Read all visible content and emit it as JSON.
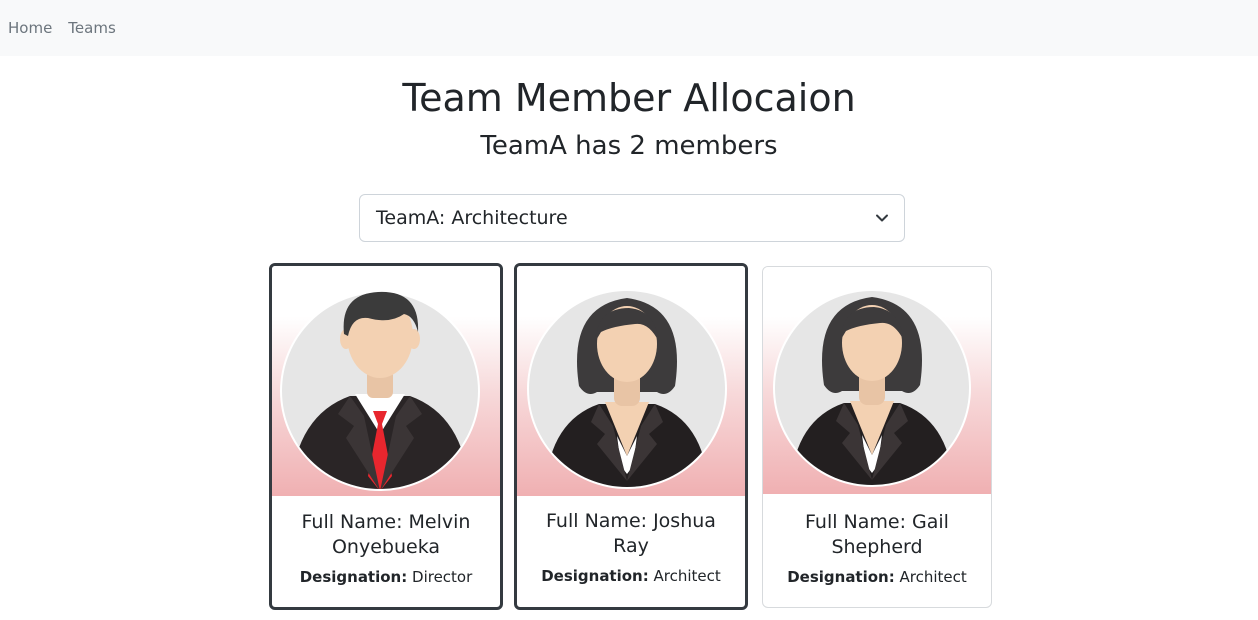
{
  "nav": {
    "items": [
      {
        "label": "Home"
      },
      {
        "label": "Teams"
      }
    ]
  },
  "header": {
    "title": "Team Member Allocaion",
    "subtitle": "TeamA has 2 members"
  },
  "team_select": {
    "value": "TeamA: Architecture"
  },
  "members": [
    {
      "name": "Full Name: Melvin Onyebueka",
      "designation_label": "Designation:",
      "designation": "Director",
      "avatar": "male-avatar-icon"
    },
    {
      "name": "Full Name: Joshua Ray",
      "designation_label": "Designation:",
      "designation": "Architect",
      "avatar": "female-avatar-icon"
    },
    {
      "name": "Full Name: Gail Shepherd",
      "designation_label": "Designation:",
      "designation": "Architect",
      "avatar": "female-avatar-icon"
    }
  ],
  "colors": {
    "navbar_bg": "#f8f9fa",
    "selected_border": "#343a40",
    "gradient_bottom": "#f0b0b2",
    "tie": "#e8262e"
  }
}
